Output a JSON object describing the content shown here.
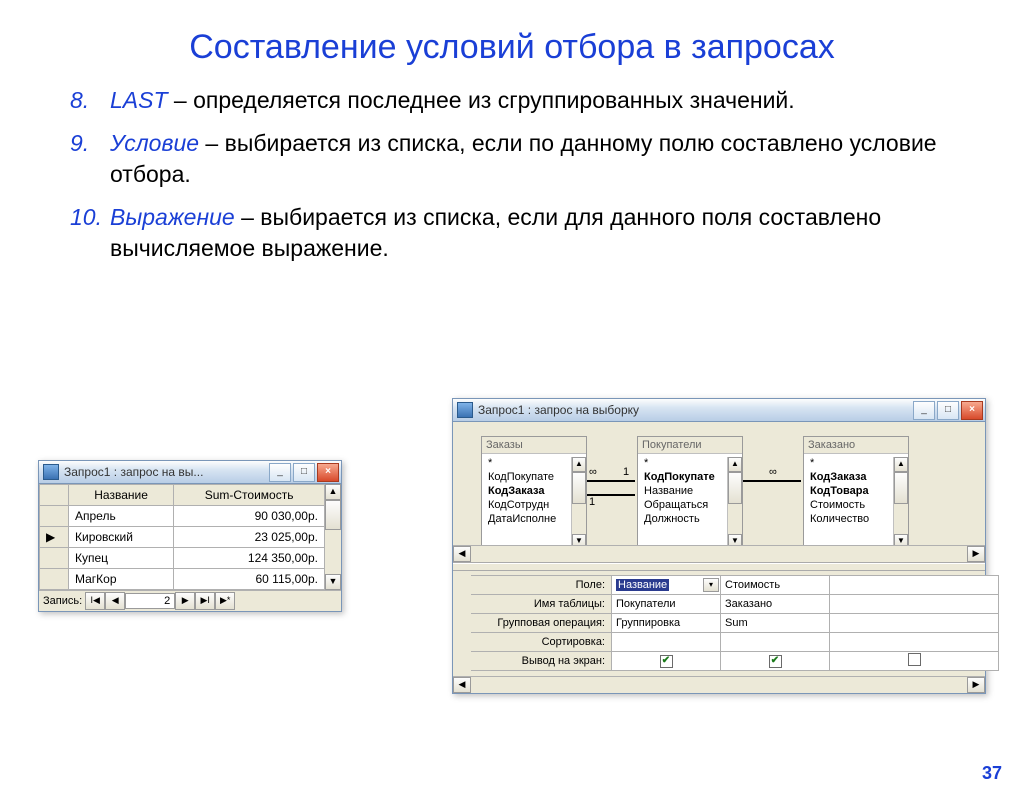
{
  "title": "Составление условий отбора в запросах",
  "bullets": [
    {
      "n": "8.",
      "term": "LAST",
      "dash": " –  ",
      "text": "определяется последнее из сгруппированных значений."
    },
    {
      "n": "9.",
      "term": "Условие",
      "dash": " – ",
      "text": "выбирается из списка, если по данному полю составлено условие отбора."
    },
    {
      "n": "10.",
      "term": "Выражение",
      "dash": "  – ",
      "text": "выбирается из списка, если для данного поля составлено вычисляемое выражение."
    }
  ],
  "page_num": "37",
  "win_left": {
    "title": "Запрос1 : запрос на вы...",
    "col1": "Название",
    "col2": "Sum-Стоимость",
    "rows": [
      {
        "sel": "",
        "name": "Апрель",
        "sum": "90 030,00р."
      },
      {
        "sel": "▶",
        "name": "Кировский",
        "sum": "23 025,00р."
      },
      {
        "sel": "",
        "name": "Купец",
        "sum": "124 350,00р."
      },
      {
        "sel": "",
        "name": "МагКор",
        "sum": "60 115,00р."
      }
    ],
    "nav_label": "Запись:",
    "nav_pos": "2"
  },
  "win_right": {
    "title": "Запрос1 : запрос на выборку",
    "tables": {
      "t1": {
        "title": "Заказы",
        "items": [
          "*",
          "КодПокупате",
          "КодЗаказа",
          "КодСотрудн",
          "ДатаИсполне"
        ],
        "boldIdx": 2
      },
      "t2": {
        "title": "Покупатели",
        "items": [
          "*",
          "КодПокупате",
          "Название",
          "Обращаться",
          "Должность"
        ],
        "boldIdx": 1
      },
      "t3": {
        "title": "Заказано",
        "items": [
          "*",
          "КодЗаказа",
          "КодТовара",
          "Стоимость",
          "Количество"
        ],
        "boldIdx": 1
      }
    },
    "rel": {
      "l1a": "∞",
      "l1b": "1",
      "l2a": "1",
      "l2b": "∞"
    },
    "qbe": {
      "labels": {
        "field": "Поле:",
        "table": "Имя таблицы:",
        "group": "Групповая операция:",
        "sort": "Сортировка:",
        "show": "Вывод на экран:"
      },
      "c1": {
        "field": "Название",
        "table": "Покупатели",
        "group": "Группировка",
        "show": true
      },
      "c2": {
        "field": "Стоимость",
        "table": "Заказано",
        "group": "Sum",
        "show": true
      }
    }
  }
}
